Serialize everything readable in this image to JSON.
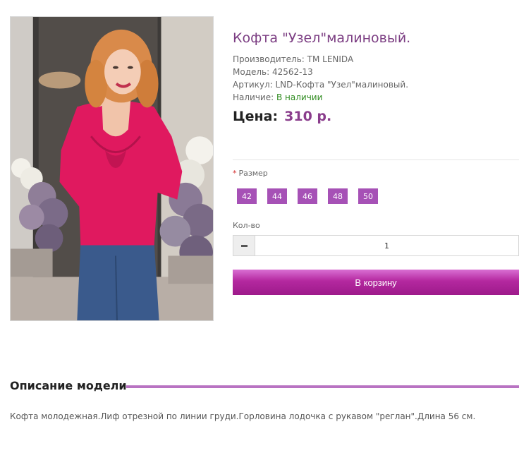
{
  "product": {
    "title": "Кофта \"Узел\"малиновый.",
    "manufacturer": "Производитель: TM LENIDA",
    "model": "Модель: 42562-13",
    "sku": "Артикул: LND-Кофта \"Узел\"малиновый.",
    "availability_label": "Наличие: ",
    "availability_value": "В наличии",
    "price_label": "Цена:",
    "price_value": "310 р."
  },
  "options": {
    "required_mark": "*",
    "size_label": "Размер",
    "sizes": [
      "42",
      "44",
      "46",
      "48",
      "50"
    ],
    "qty_label": "Кол-во",
    "qty_value": "1"
  },
  "cart_button": "В корзину",
  "description": {
    "heading": "Описание модели",
    "text": "Кофта молодежная.Лиф отрезной по линии груди.Горловина лодочка с рукавом \"реглан\".Длина 56 см."
  },
  "colors": {
    "accent": "#a651b6",
    "title": "#7b3d82",
    "in_stock": "#2e8b1e"
  }
}
